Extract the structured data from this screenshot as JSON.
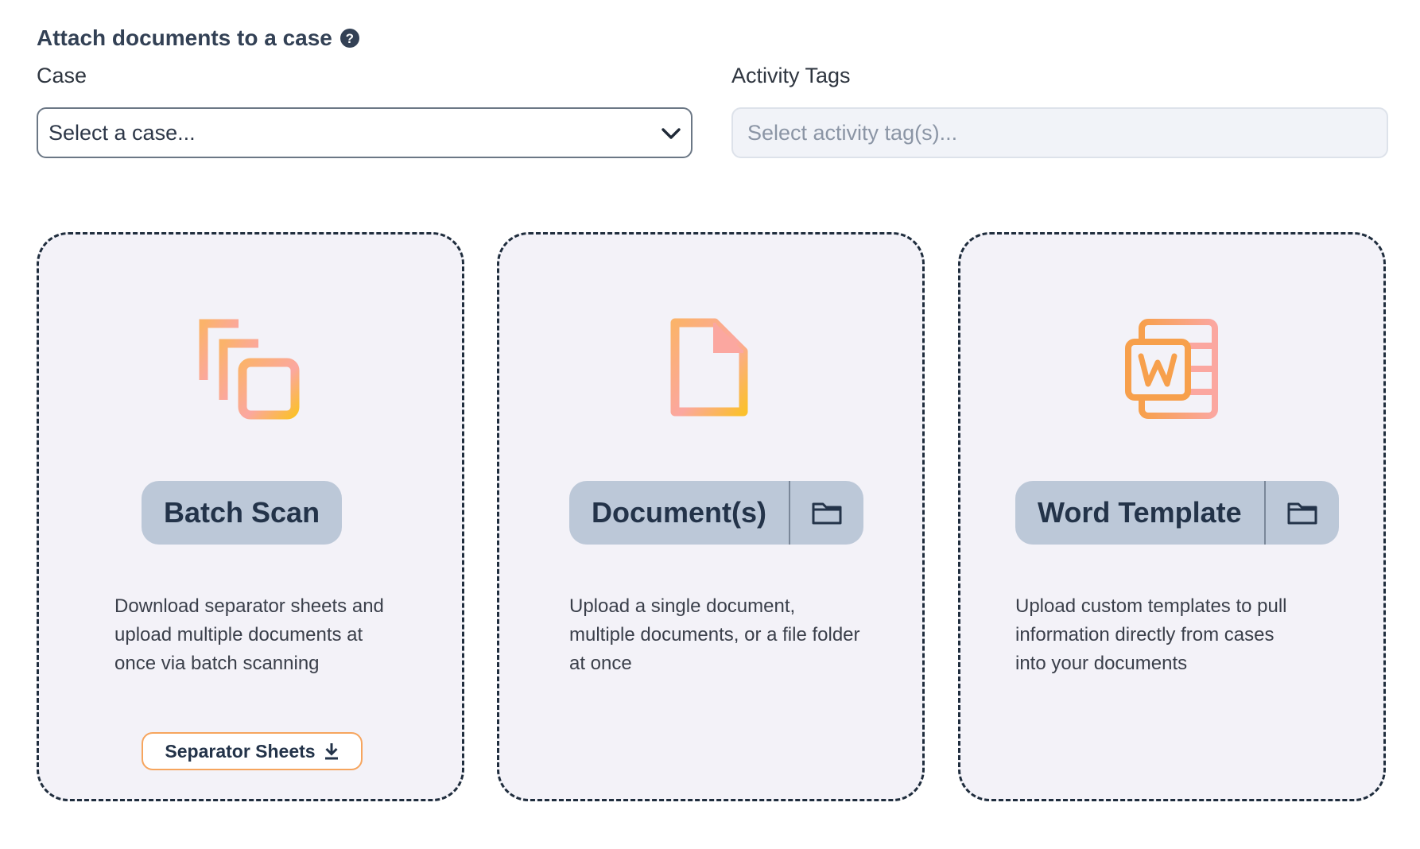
{
  "header": {
    "title": "Attach documents to a case",
    "help_icon": "question-circle-icon"
  },
  "case_field": {
    "label": "Case",
    "placeholder": "Select a case..."
  },
  "tags_field": {
    "label": "Activity Tags",
    "placeholder": "Select activity tag(s)..."
  },
  "colors": {
    "accent_orange": "#f6a55e",
    "accent_pink": "#fba7a0",
    "accent_yellow": "#fbc02d",
    "button_bg": "#bcc8d8",
    "card_bg": "#f3f2f8"
  },
  "cards": [
    {
      "icon": "stacked-pages-icon",
      "button_label": "Batch Scan",
      "description": "Download separator sheets and upload multiple documents at once via batch scanning",
      "secondary_button": "Separator Sheets",
      "secondary_icon": "download-icon"
    },
    {
      "icon": "document-icon",
      "button_label": "Document(s)",
      "folder_icon": "folder-icon",
      "description": "Upload a single document, multiple documents, or a file folder at once"
    },
    {
      "icon": "word-icon",
      "button_label": "Word Template",
      "folder_icon": "folder-icon",
      "description": "Upload custom templates to pull information directly from cases into your documents"
    }
  ]
}
